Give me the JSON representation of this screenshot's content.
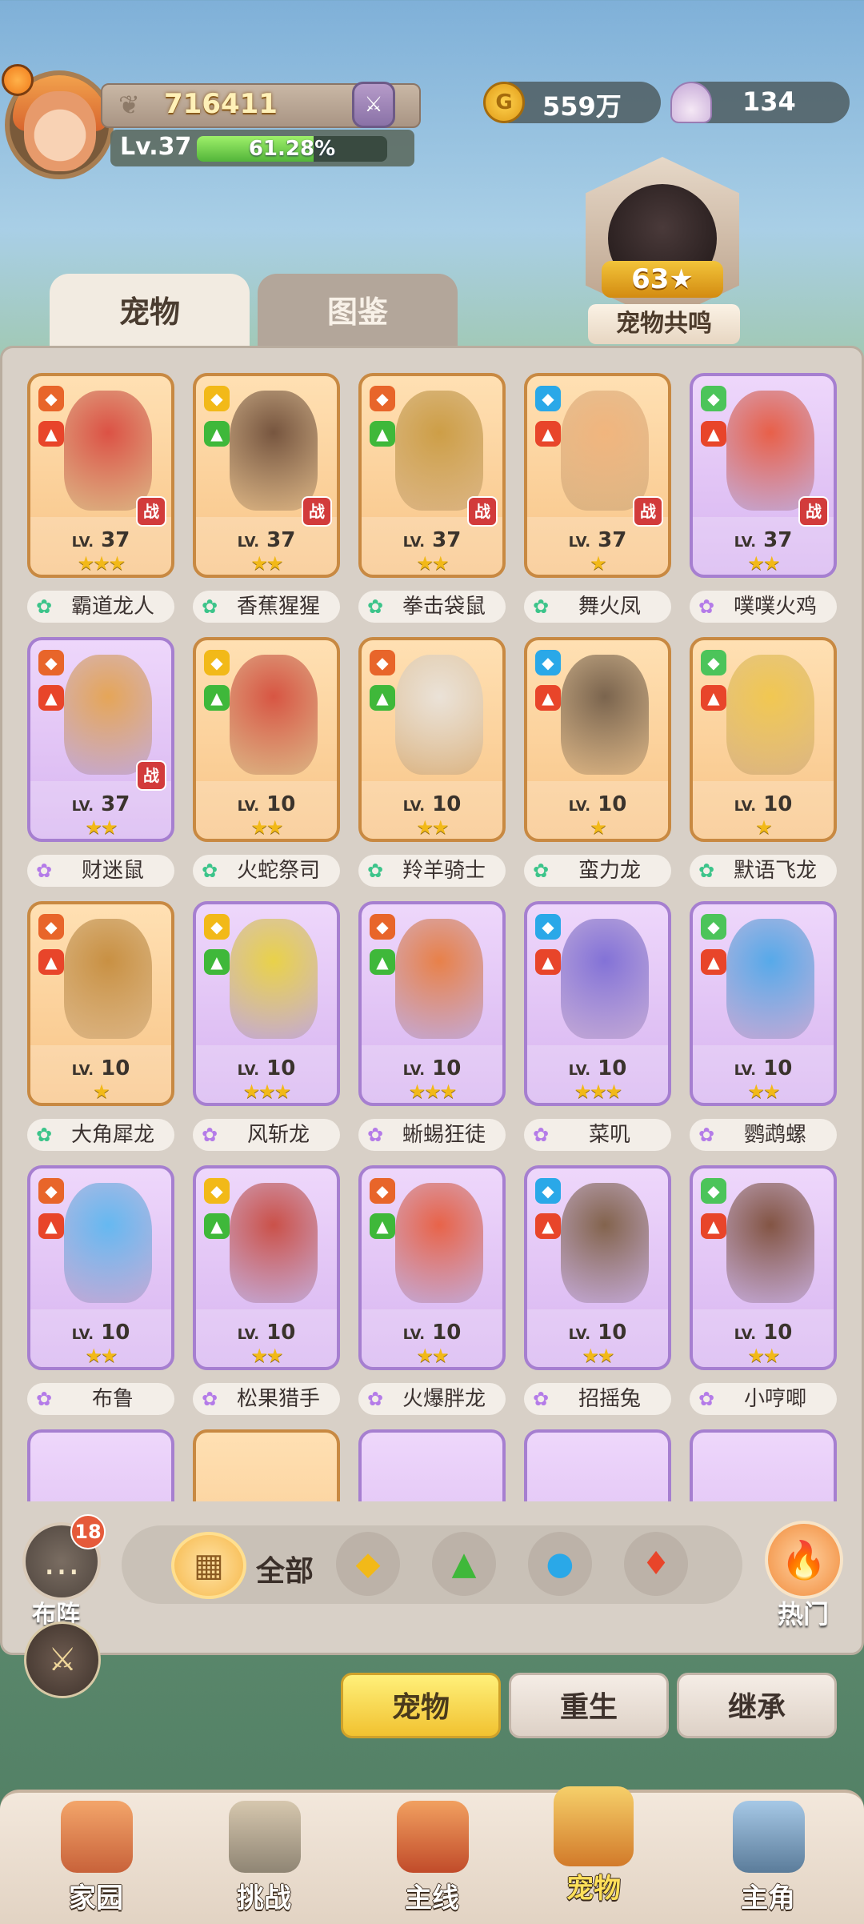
{
  "header": {
    "power_value": "716411",
    "level_label": "Lv.37",
    "exp_percent_text": "61.28%",
    "exp_fraction": 0.6128,
    "gold_amount": "559万",
    "shell_amount": "134"
  },
  "resonance": {
    "count": "63",
    "label": "宠物共鸣"
  },
  "tabs": [
    {
      "label": "宠物"
    },
    {
      "label": "图鉴"
    }
  ],
  "pets": [
    {
      "name": "霸道龙人",
      "lv": "37",
      "stars": "★★★",
      "rarity": "orange",
      "battle": true,
      "battle_label": "战"
    },
    {
      "name": "香蕉猩猩",
      "lv": "37",
      "stars": "★★",
      "rarity": "orange",
      "battle": true,
      "battle_label": "战"
    },
    {
      "name": "拳击袋鼠",
      "lv": "37",
      "stars": "★★",
      "rarity": "orange",
      "battle": true,
      "battle_label": "战"
    },
    {
      "name": "舞火凤",
      "lv": "37",
      "stars": "★",
      "rarity": "orange",
      "battle": true,
      "battle_label": "战"
    },
    {
      "name": "噗噗火鸡",
      "lv": "37",
      "stars": "★★",
      "rarity": "purple",
      "battle": true,
      "battle_label": "战"
    },
    {
      "name": "财迷鼠",
      "lv": "37",
      "stars": "★★",
      "rarity": "purple",
      "battle": true,
      "battle_label": "战"
    },
    {
      "name": "火蛇祭司",
      "lv": "10",
      "stars": "★★",
      "rarity": "orange",
      "battle": false
    },
    {
      "name": "羚羊骑士",
      "lv": "10",
      "stars": "★★",
      "rarity": "orange",
      "battle": false
    },
    {
      "name": "蛮力龙",
      "lv": "10",
      "stars": "★",
      "rarity": "orange",
      "battle": false
    },
    {
      "name": "默语飞龙",
      "lv": "10",
      "stars": "★",
      "rarity": "orange",
      "battle": false
    },
    {
      "name": "大角犀龙",
      "lv": "10",
      "stars": "★",
      "rarity": "orange",
      "battle": false
    },
    {
      "name": "风斩龙",
      "lv": "10",
      "stars": "★★★",
      "rarity": "purple",
      "battle": false
    },
    {
      "name": "蜥蜴狂徒",
      "lv": "10",
      "stars": "★★★",
      "rarity": "purple",
      "battle": false
    },
    {
      "name": "菜叽",
      "lv": "10",
      "stars": "★★★",
      "rarity": "purple",
      "battle": false
    },
    {
      "name": "鹦鹉螺",
      "lv": "10",
      "stars": "★★",
      "rarity": "purple",
      "battle": false
    },
    {
      "name": "布鲁",
      "lv": "10",
      "stars": "★★",
      "rarity": "purple",
      "battle": false
    },
    {
      "name": "松果猎手",
      "lv": "10",
      "stars": "★★",
      "rarity": "purple",
      "battle": false
    },
    {
      "name": "火爆胖龙",
      "lv": "10",
      "stars": "★★",
      "rarity": "purple",
      "battle": false
    },
    {
      "name": "招摇兔",
      "lv": "10",
      "stars": "★★",
      "rarity": "purple",
      "battle": false
    },
    {
      "name": "小哼唧",
      "lv": "10",
      "stars": "★★",
      "rarity": "purple",
      "battle": false
    }
  ],
  "lv_prefix": "LV.",
  "filter": {
    "all_label": "全部",
    "lineup_label": "布阵",
    "chat_badge": "18",
    "hot_label": "热门"
  },
  "actions": [
    {
      "label": "宠物"
    },
    {
      "label": "重生"
    },
    {
      "label": "继承"
    }
  ],
  "nav": [
    {
      "label": "家园"
    },
    {
      "label": "挑战"
    },
    {
      "label": "主线"
    },
    {
      "label": "宠物"
    },
    {
      "label": "主角"
    }
  ],
  "colors": {
    "accent": "#f1c230",
    "panel": "#d8d0c7"
  }
}
